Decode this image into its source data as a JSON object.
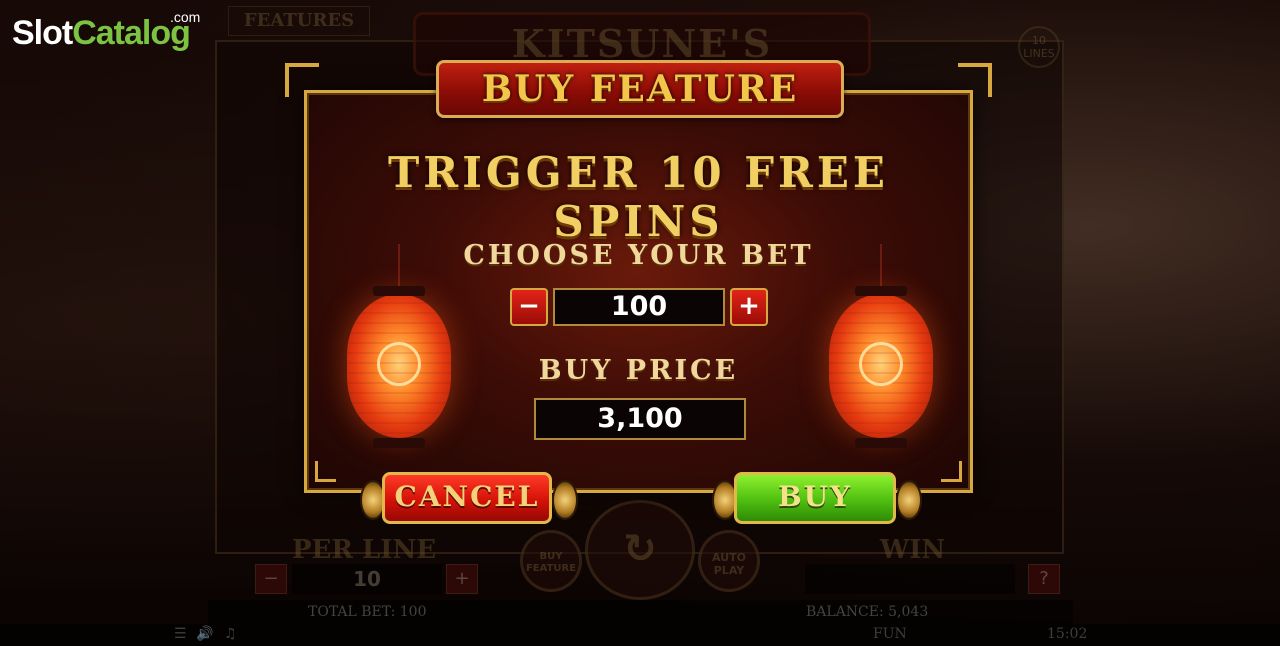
{
  "branding": {
    "logo_part1": "Slot",
    "logo_part2": "Catalog",
    "logo_suffix": ".com"
  },
  "game": {
    "title": "KITSUNE'S SCROLLS",
    "features_tab": "FEATURES",
    "lines_badge": {
      "count": "10",
      "label": "LINES"
    },
    "per_line_label": "PER LINE",
    "per_line_value": "10",
    "minus_symbol": "−",
    "plus_symbol": "+",
    "win_label": "WIN",
    "help_symbol": "?",
    "buy_feature_round": "BUY FEATURE",
    "autoplay_round": "AUTO PLAY",
    "total_bet": "TOTAL BET: 100",
    "balance": "BALANCE: 5,043",
    "mode": "FUN",
    "clock": "15:02"
  },
  "dialog": {
    "title": "BUY FEATURE",
    "headline": "TRIGGER 10 FREE SPINS",
    "choose_bet_label": "CHOOSE YOUR BET",
    "bet_minus": "−",
    "bet_value": "100",
    "bet_plus": "+",
    "buy_price_label": "BUY PRICE",
    "buy_price_value": "3,100",
    "cancel_label": "CANCEL",
    "buy_label": "BUY"
  },
  "colors": {
    "accent_gold": "#d6a83f",
    "cancel_red": "#d41208",
    "buy_green": "#4fbf10",
    "logo_green": "#7cc243"
  }
}
